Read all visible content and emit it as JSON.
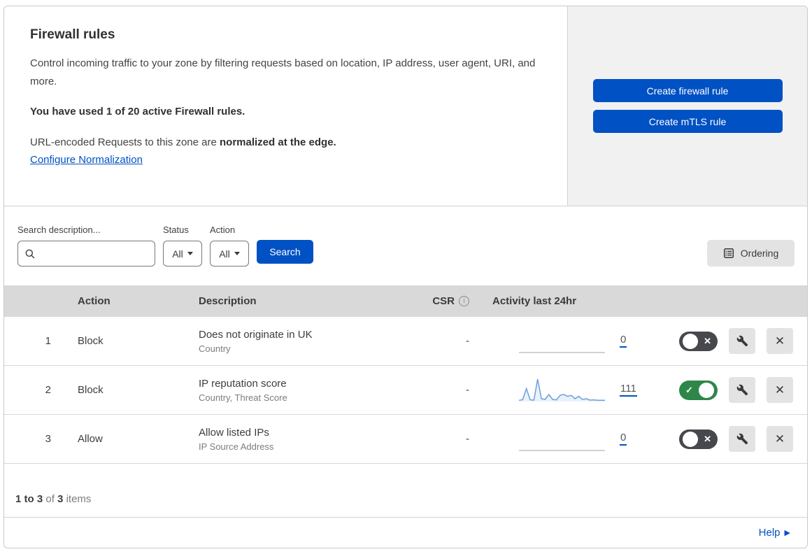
{
  "header": {
    "title": "Firewall rules",
    "description": "Control incoming traffic to your zone by filtering requests based on location, IP address, user agent, URI, and more.",
    "usage": "You have used 1 of 20 active Firewall rules.",
    "normalization_prefix": "URL-encoded Requests to this zone are ",
    "normalization_bold": "normalized at the edge.",
    "normalization_link": "Configure Normalization",
    "create_firewall_label": "Create firewall rule",
    "create_mtls_label": "Create mTLS rule"
  },
  "filters": {
    "search_label": "Search description...",
    "search_value": "",
    "status_label": "Status",
    "status_value": "All",
    "action_label": "Action",
    "action_value": "All",
    "search_button": "Search",
    "ordering_button": "Ordering"
  },
  "table": {
    "headers": {
      "action": "Action",
      "description": "Description",
      "csr": "CSR",
      "activity": "Activity last 24hr"
    },
    "rows": [
      {
        "number": "1",
        "action": "Block",
        "description": "Does not originate in UK",
        "criteria": "Country",
        "csr": "-",
        "activity_count": "0",
        "enabled": false,
        "sparkline": [
          0,
          0,
          0,
          0,
          0,
          0,
          0,
          0,
          0,
          0,
          0,
          0,
          0,
          0,
          0,
          0,
          0,
          0,
          0,
          0,
          0,
          0,
          0,
          0
        ]
      },
      {
        "number": "2",
        "action": "Block",
        "description": "IP reputation score",
        "criteria": "Country, Threat Score",
        "csr": "-",
        "activity_count": "111",
        "enabled": true,
        "sparkline": [
          5,
          8,
          55,
          7,
          6,
          95,
          12,
          9,
          30,
          9,
          7,
          26,
          30,
          22,
          26,
          12,
          22,
          9,
          12,
          6,
          7,
          5,
          5,
          5
        ]
      },
      {
        "number": "3",
        "action": "Allow",
        "description": "Allow listed IPs",
        "criteria": "IP Source Address",
        "csr": "-",
        "activity_count": "0",
        "enabled": false,
        "sparkline": [
          0,
          0,
          0,
          0,
          0,
          0,
          0,
          0,
          0,
          0,
          0,
          0,
          0,
          0,
          0,
          0,
          0,
          0,
          0,
          0,
          0,
          0,
          0,
          0
        ]
      }
    ]
  },
  "footer": {
    "pagination": {
      "range": "1 to 3",
      "of": "of",
      "total": "3",
      "items": "items"
    },
    "help": "Help"
  },
  "icons": {
    "toggle_on_mark": "✓",
    "toggle_off_mark": "✕",
    "close": "✕",
    "info": "i",
    "help_arrow": "▶"
  },
  "colors": {
    "accent": "#0051c3",
    "toggle_on": "#2e8648",
    "toggle_off": "#47484d",
    "spark_line": "#6d9fdc",
    "header_bg": "#d9d9d9"
  }
}
